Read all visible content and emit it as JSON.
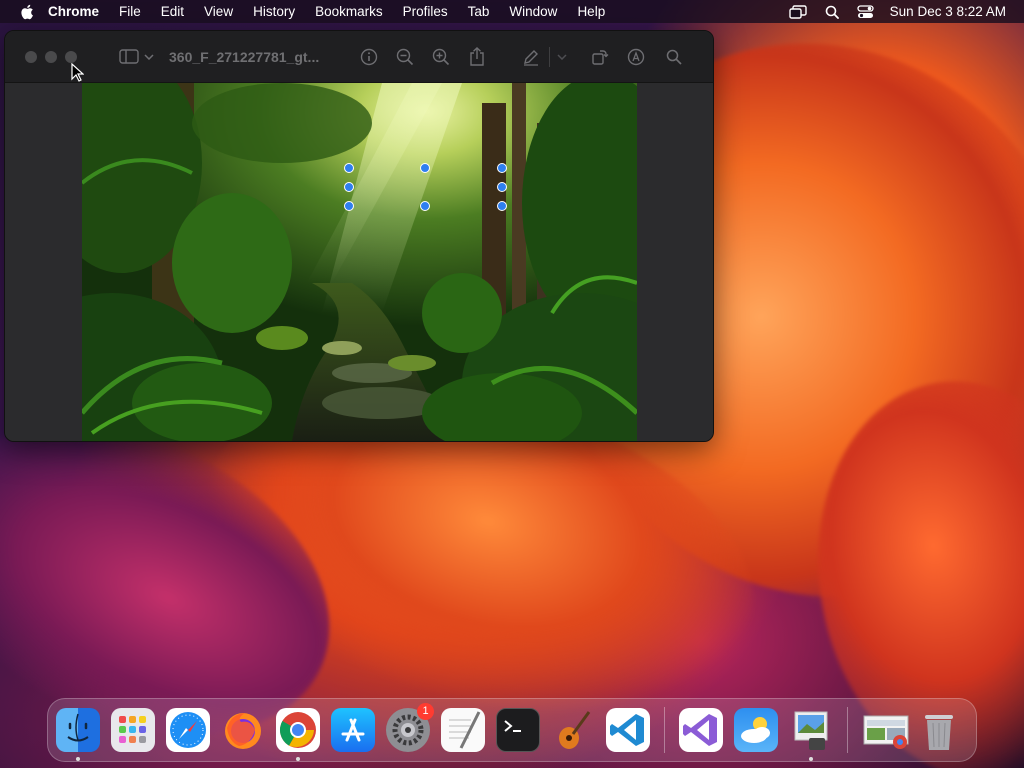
{
  "menubar": {
    "app_name": "Chrome",
    "items": [
      "File",
      "Edit",
      "View",
      "History",
      "Bookmarks",
      "Profiles",
      "Tab",
      "Window",
      "Help"
    ],
    "clock": "Sun Dec 3  8:22 AM"
  },
  "window": {
    "title": "360_F_271227781_gt...",
    "app": "Preview"
  },
  "dock": {
    "items": [
      {
        "name": "Finder",
        "running": true
      },
      {
        "name": "Launchpad",
        "running": false
      },
      {
        "name": "Safari",
        "running": false
      },
      {
        "name": "Firefox",
        "running": false
      },
      {
        "name": "Google Chrome",
        "running": true
      },
      {
        "name": "App Store",
        "running": false
      },
      {
        "name": "System Settings",
        "running": false,
        "badge": "1"
      },
      {
        "name": "TextEdit",
        "running": false
      },
      {
        "name": "Terminal",
        "running": false
      },
      {
        "name": "GarageBand",
        "running": false
      },
      {
        "name": "Visual Studio Code",
        "running": false
      },
      {
        "name": "Visual Studio",
        "running": false
      },
      {
        "name": "Weather",
        "running": false
      },
      {
        "name": "Preview",
        "running": true
      },
      {
        "name": "Screenshot",
        "running": false
      },
      {
        "name": "Trash",
        "running": false
      }
    ]
  },
  "colors": {
    "selection_handle": "#2f7ff0",
    "badge": "#ff3b30"
  }
}
